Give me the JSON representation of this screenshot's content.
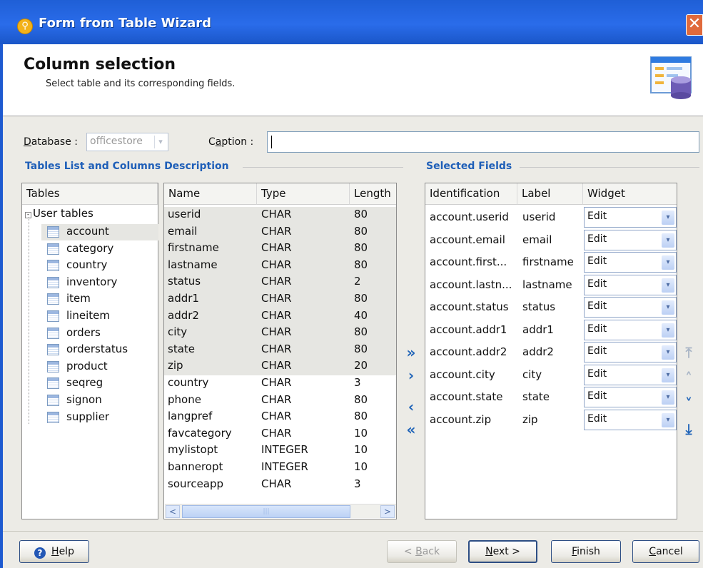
{
  "window": {
    "title": "Form from Table Wizard",
    "close": "✕"
  },
  "header": {
    "heading": "Column selection",
    "subtitle": "Select table and its corresponding fields."
  },
  "form": {
    "database_label": "Database :",
    "database_value": "officestore",
    "caption_label": "Caption :",
    "caption_value": ""
  },
  "tables_group": {
    "title": "Tables List and Columns Description",
    "tree_header": "Tables",
    "root_label": "User tables",
    "tables": [
      "account",
      "category",
      "country",
      "inventory",
      "item",
      "lineitem",
      "orders",
      "orderstatus",
      "product",
      "seqreg",
      "signon",
      "supplier"
    ],
    "selected_table": "account",
    "columns_headers": [
      "Name",
      "Type",
      "Length"
    ],
    "columns": [
      {
        "name": "userid",
        "type": "CHAR",
        "length": "80"
      },
      {
        "name": "email",
        "type": "CHAR",
        "length": "80"
      },
      {
        "name": "firstname",
        "type": "CHAR",
        "length": "80"
      },
      {
        "name": "lastname",
        "type": "CHAR",
        "length": "80"
      },
      {
        "name": "status",
        "type": "CHAR",
        "length": "2"
      },
      {
        "name": "addr1",
        "type": "CHAR",
        "length": "80"
      },
      {
        "name": "addr2",
        "type": "CHAR",
        "length": "40"
      },
      {
        "name": "city",
        "type": "CHAR",
        "length": "80"
      },
      {
        "name": "state",
        "type": "CHAR",
        "length": "80"
      },
      {
        "name": "zip",
        "type": "CHAR",
        "length": "20"
      },
      {
        "name": "country",
        "type": "CHAR",
        "length": "3"
      },
      {
        "name": "phone",
        "type": "CHAR",
        "length": "80"
      },
      {
        "name": "langpref",
        "type": "CHAR",
        "length": "80"
      },
      {
        "name": "favcategory",
        "type": "CHAR",
        "length": "10"
      },
      {
        "name": "mylistopt",
        "type": "INTEGER",
        "length": "10"
      },
      {
        "name": "banneropt",
        "type": "INTEGER",
        "length": "10"
      },
      {
        "name": "sourceapp",
        "type": "CHAR",
        "length": "3"
      }
    ],
    "highlighted_rows": 10
  },
  "selected_group": {
    "title": "Selected Fields",
    "headers": [
      "Identification",
      "Label",
      "Widget"
    ],
    "rows": [
      {
        "identification": "account.userid",
        "label": "userid",
        "widget": "Edit"
      },
      {
        "identification": "account.email",
        "label": "email",
        "widget": "Edit"
      },
      {
        "identification": "account.first...",
        "label": "firstname",
        "widget": "Edit"
      },
      {
        "identification": "account.lastn...",
        "label": "lastname",
        "widget": "Edit"
      },
      {
        "identification": "account.status",
        "label": "status",
        "widget": "Edit"
      },
      {
        "identification": "account.addr1",
        "label": "addr1",
        "widget": "Edit"
      },
      {
        "identification": "account.addr2",
        "label": "addr2",
        "widget": "Edit"
      },
      {
        "identification": "account.city",
        "label": "city",
        "widget": "Edit"
      },
      {
        "identification": "account.state",
        "label": "state",
        "widget": "Edit"
      },
      {
        "identification": "account.zip",
        "label": "zip",
        "widget": "Edit"
      }
    ]
  },
  "movers": {
    "add_all": "»",
    "add": "›",
    "remove": "‹",
    "remove_all": "«"
  },
  "order_buttons": {
    "top": "⤒",
    "up": "˄",
    "down": "˅",
    "bottom": "⤓"
  },
  "buttons": {
    "help_key": "H",
    "help_rest": "elp",
    "back_prefix": "< ",
    "back_key": "B",
    "back_rest": "ack",
    "next_key": "N",
    "next_rest": "ext >",
    "finish_key": "F",
    "finish_rest": "inish",
    "cancel_key": "C",
    "cancel_rest": "ancel"
  },
  "colors": {
    "title_bar": "#2a6cea",
    "group_title": "#1f5fb8",
    "mover_arrow": "#1e63b8",
    "background": "#ecebe6"
  }
}
